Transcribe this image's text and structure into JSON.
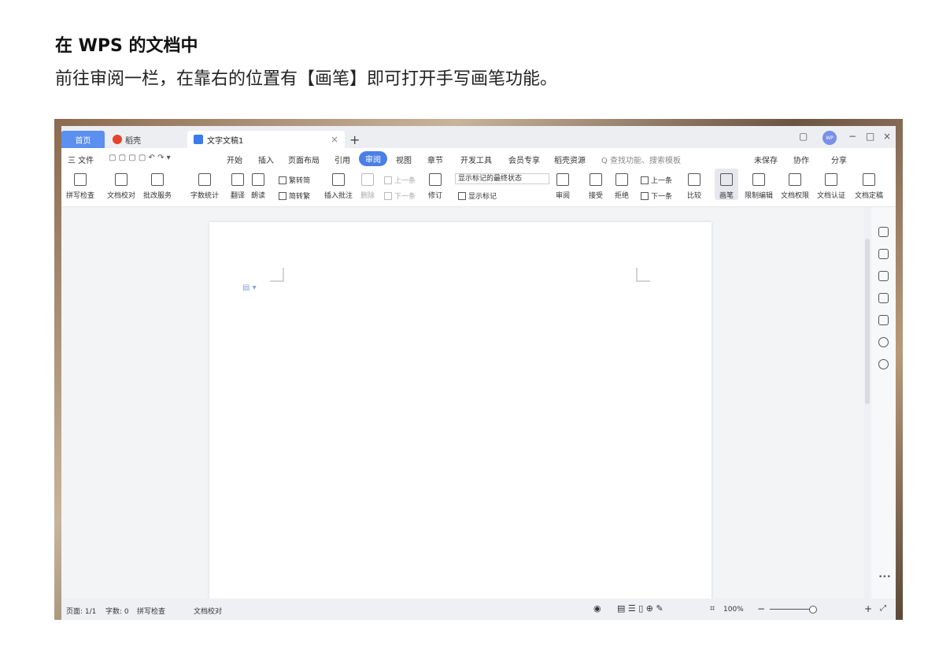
{
  "heading": "在 WPS 的文档中",
  "paragraph": "前往审阅一栏，在靠右的位置有【画笔】即可打开手写画笔功能。",
  "tabs": {
    "home": "首页",
    "daoke": "稻壳",
    "doc": "文字文稿1",
    "close": "×",
    "plus": "+"
  },
  "window_controls": {
    "minimize": "−",
    "maximize": "□",
    "close": "×",
    "avatar": "WP"
  },
  "menu": {
    "file": "三 文件",
    "items": [
      "开始",
      "插入",
      "页面布局",
      "引用",
      "审阅",
      "视图",
      "章节",
      "开发工具",
      "会员专享",
      "稻壳资源"
    ],
    "active": "审阅",
    "search": "Q 查找功能、搜索模板",
    "unsaved": "未保存",
    "collab": "协作",
    "share": "分享"
  },
  "ribbon": {
    "spellcheck": "拼写检查",
    "doccheck": "文档校对",
    "batchservice": "批改服务",
    "wordcount": "字数统计",
    "translate": "翻译",
    "read": "朗读",
    "trad2simp": "繁转简",
    "simp2trad": "简转繁",
    "insertcomment": "插入批注",
    "delete": "删除",
    "prev": "上一条",
    "next": "下一条",
    "revise": "修订",
    "markup_state": "显示标记的最终状态",
    "show_markup": "显示标记",
    "review": "审阅",
    "accept": "接受",
    "reject": "拒绝",
    "prev2": "上一条",
    "next2": "下一条",
    "compare": "比较",
    "pen": "画笔",
    "restrict": "限制编辑",
    "permission": "文档权限",
    "certify": "文档认证",
    "finalize": "文档定稿"
  },
  "status": {
    "page": "页面: 1/1",
    "words": "字数: 0",
    "spellcheck": "拼写检查",
    "doccheck": "文档校对",
    "zoom": "100%",
    "minus": "−",
    "plus": "+"
  }
}
